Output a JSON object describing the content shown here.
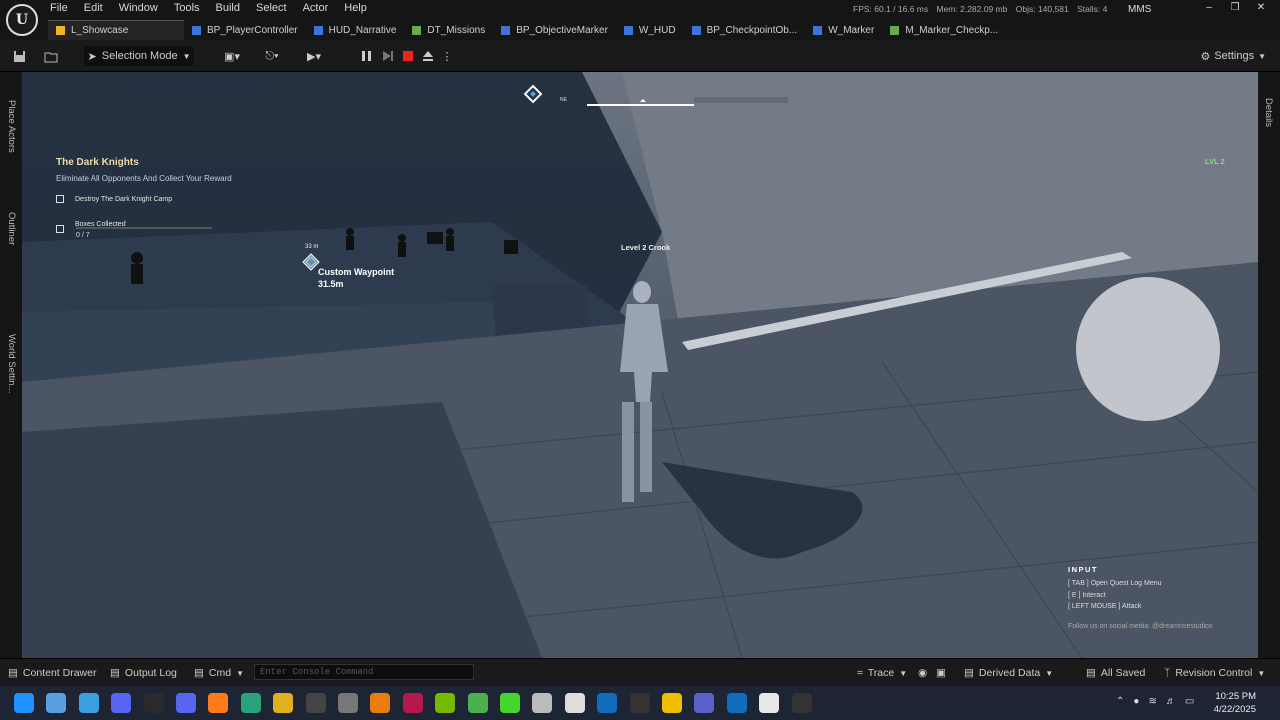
{
  "menu": [
    "File",
    "Edit",
    "Window",
    "Tools",
    "Build",
    "Select",
    "Actor",
    "Help"
  ],
  "stats": [
    "FPS: 60.1 / 16.6 ms",
    "Mem: 2,282.09 mb",
    "Objs: 140,581",
    "Stalls: 4"
  ],
  "user": "MMS",
  "tabs": [
    {
      "label": "L_Showcase",
      "color": "#f0b429"
    },
    {
      "label": "BP_PlayerController",
      "color": "#3d74d9"
    },
    {
      "label": "HUD_Narrative",
      "color": "#3d74d9"
    },
    {
      "label": "DT_Missions",
      "color": "#6aa84f"
    },
    {
      "label": "BP_ObjectiveMarker",
      "color": "#3d74d9"
    },
    {
      "label": "W_HUD",
      "color": "#3d74d9"
    },
    {
      "label": "BP_CheckpointOb...",
      "color": "#3d74d9"
    },
    {
      "label": "W_Marker",
      "color": "#3d74d9"
    },
    {
      "label": "M_Marker_Checkp...",
      "color": "#6aa84f"
    }
  ],
  "toolbar": {
    "selection_mode": "Selection Mode",
    "settings": "Settings"
  },
  "side_left": [
    "Place Actors",
    "Outliner",
    "World Settin..."
  ],
  "side_right": [
    "Details"
  ],
  "hud": {
    "mission_title": "The Dark Knights",
    "mission_subtitle": "Eliminate All Opponents And Collect Your Reward",
    "objective_1": "Destroy The Dark Knight Camp",
    "objective_2": "Boxes Collected",
    "objective_2_count": "0 / 7",
    "objective_2_progress": 0,
    "level": "LVL 2",
    "enemy_label": "Level 2 Crook",
    "marker_distance": "33 m",
    "waypoint_name": "Custom Waypoint",
    "waypoint_distance": "31.5m",
    "compass_heading": "NE",
    "input_header": "INPUT",
    "input_lines": [
      "[ TAB ] Open Quest Log Menu",
      "[ E ] Interact",
      "[ LEFT MOUSE ] Attack"
    ],
    "social": "Follow us on social media: @dreamrisestudios"
  },
  "bottom": {
    "content_drawer": "Content Drawer",
    "output_log": "Output Log",
    "cmd": "Cmd",
    "console_placeholder": "Enter Console Command",
    "trace": "Trace",
    "derived_data": "Derived Data",
    "all_saved": "All Saved",
    "revision_control": "Revision Control"
  },
  "taskbar": {
    "time": "10:25 PM",
    "date": "4/22/2025",
    "apps": [
      "windows-start",
      "file-explorer",
      "desktop",
      "discord",
      "steam",
      "discord-blue",
      "firefox",
      "edge",
      "chrome",
      "obs",
      "notes",
      "blender",
      "indesign",
      "nvidia-app",
      "minecraft",
      "razer",
      "app-dev",
      "unity",
      "outlook",
      "epic-games",
      "folder",
      "teams",
      "outlook-alt",
      "unreal",
      "epic-alt"
    ],
    "app_colors": [
      "#1e90ff",
      "#5aa0e0",
      "#3aa0e0",
      "#5865f2",
      "#2a2a2a",
      "#5865f2",
      "#ff7a1a",
      "#2aa37a",
      "#e0b020",
      "#444",
      "#777",
      "#e87d0d",
      "#b5174f",
      "#76b900",
      "#4caf50",
      "#44d62c",
      "#bbb",
      "#ddd",
      "#0f6cbd",
      "#333",
      "#f0c000",
      "#5b5fc7",
      "#0f6cbd",
      "#e8e8e8",
      "#333"
    ]
  }
}
